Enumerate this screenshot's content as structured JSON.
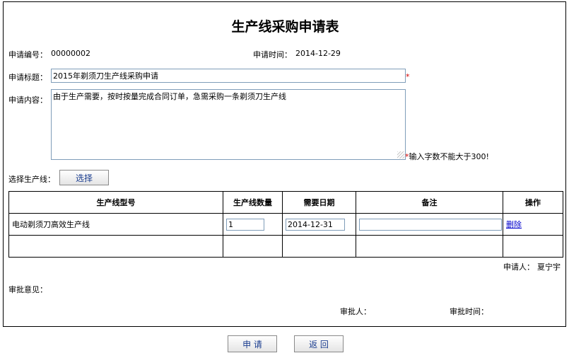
{
  "form": {
    "title": "生产线采购申请表",
    "request_no_label": "申请编号：",
    "request_no": "00000002",
    "request_time_label": "申请时间：",
    "request_time": "2014-12-29",
    "subject_label": "申请标题：",
    "subject_value": "2015年剃须刀生产线采购申请",
    "required_mark": "*",
    "content_label": "申请内容：",
    "content_value": "由于生产需要，按时按量完成合同订单，急需采购一条剃须刀生产线",
    "content_hint": "*输入字数不能大于300!",
    "select_line_label": "选择生产线：",
    "select_button": "选择"
  },
  "table": {
    "headers": [
      "生产线型号",
      "生产线数量",
      "需要日期",
      "备注",
      "操作"
    ],
    "rows": [
      {
        "model": "电动剃须刀高效生产线",
        "quantity": "1",
        "date": "2014-12-31",
        "remark": "",
        "action": "删除"
      }
    ]
  },
  "footer": {
    "applicant_label": "申请人：",
    "applicant": "夏宁宇",
    "approval_opinion_label": "审批意见：",
    "approver_label": "审批人：",
    "approval_time_label": "审批时间："
  },
  "buttons": {
    "apply": "申 请",
    "back": "返 回"
  },
  "colors": {
    "required": "#d00000",
    "link": "#0000cc",
    "button_text": "#1a3d8f",
    "input_border": "#7f9db9"
  }
}
